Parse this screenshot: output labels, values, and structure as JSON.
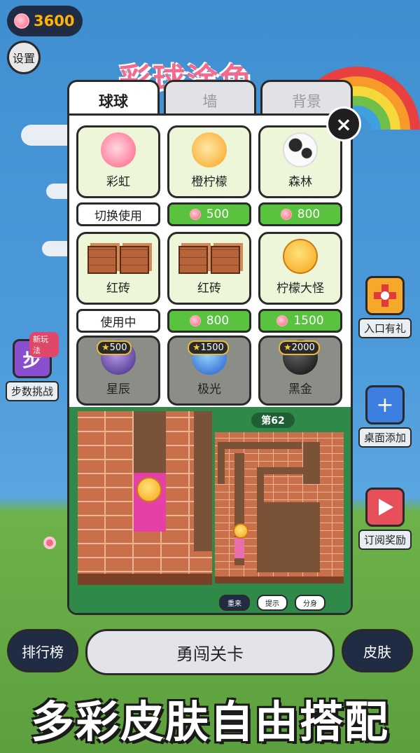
{
  "currency": {
    "amount": "3600"
  },
  "settings_label": "设置",
  "game_title_art": "彩球涂色",
  "tabs": [
    {
      "label": "球球",
      "active": true
    },
    {
      "label": "墙",
      "active": false
    },
    {
      "label": "背景",
      "active": false
    }
  ],
  "close_icon": "×",
  "skins": [
    {
      "name": "彩虹",
      "button": "切换使用",
      "button_type": "use",
      "color": "#ff7a98"
    },
    {
      "name": "橙柠檬",
      "button": "500",
      "button_type": "buy",
      "color": "#f6a41c"
    },
    {
      "name": "森林",
      "button": "800",
      "button_type": "buy",
      "color": "#ffffff"
    },
    {
      "name": "红砖",
      "button": "使用中",
      "button_type": "use"
    },
    {
      "name": "红砖",
      "button": "800",
      "button_type": "buy"
    },
    {
      "name": "柠檬大怪",
      "button": "1500",
      "button_type": "buy"
    },
    {
      "name": "星辰",
      "lock_cost": "500",
      "color": "#5a3f9e"
    },
    {
      "name": "极光",
      "lock_cost": "1500",
      "color": "#2a6fd6"
    },
    {
      "name": "黑金",
      "lock_cost": "2000",
      "color": "#111111"
    }
  ],
  "preview": {
    "level": "第62",
    "controls": [
      "重来",
      "提示",
      "分身"
    ]
  },
  "side_buttons": {
    "steps_challenge": "步数挑战",
    "steps_icon_char": "步",
    "new_badge": "新玩法",
    "entry_gift": "入口有礼",
    "desktop_add": "桌面添加",
    "subscribe_reward": "订阅奖励"
  },
  "bottom": {
    "leaderboard": "排行榜",
    "play": "勇闯关卡",
    "skins": "皮肤"
  },
  "slogan": "多彩皮肤自由搭配"
}
